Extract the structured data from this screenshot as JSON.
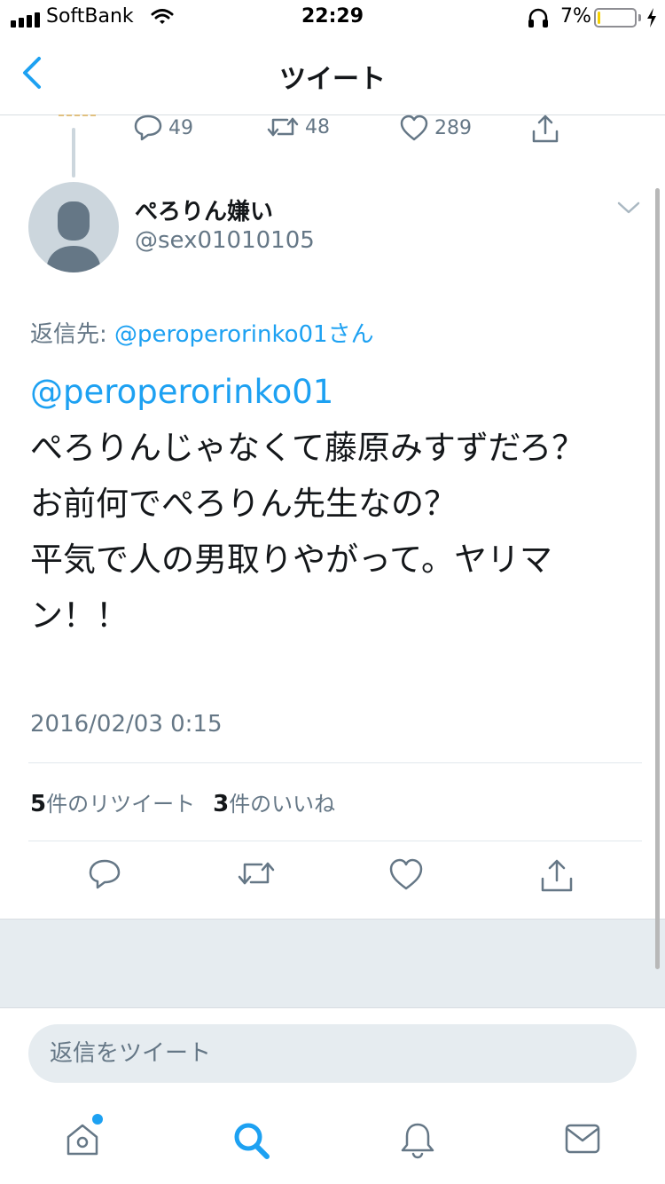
{
  "status_bar": {
    "carrier": "SoftBank",
    "time": "22:29",
    "battery_percent": "7%",
    "battery_level": 0.07
  },
  "nav": {
    "title": "ツイート"
  },
  "parent_tweet": {
    "reply_count": "49",
    "retweet_count": "48",
    "like_count": "289"
  },
  "tweet": {
    "display_name": "ぺろりん嫌い",
    "handle": "@sex01010105",
    "reply_to_prefix": "返信先: ",
    "reply_to_link": "@peroperorinko01さん",
    "mention": "@peroperorinko01",
    "text": "ぺろりんじゃなくて藤原みすずだろ？\nお前何でぺろりん先生なの？\n平気で人の男取りやがって。ヤリマン！！",
    "timestamp": "2016/02/03 0:15",
    "retweets_count": "5",
    "retweets_label": "件のリツイート",
    "likes_count": "3",
    "likes_label": "件のいいね"
  },
  "reply_bar": {
    "placeholder": "返信をツイート"
  },
  "tabs": [
    {
      "name": "home",
      "icon": "home-icon"
    },
    {
      "name": "search",
      "icon": "search-icon"
    },
    {
      "name": "notifications",
      "icon": "bell-icon"
    },
    {
      "name": "messages",
      "icon": "mail-icon"
    }
  ],
  "colors": {
    "accent": "#1da1f2",
    "secondary_text": "#657786",
    "primary_text": "#14171a",
    "battery": "#f5d000"
  }
}
